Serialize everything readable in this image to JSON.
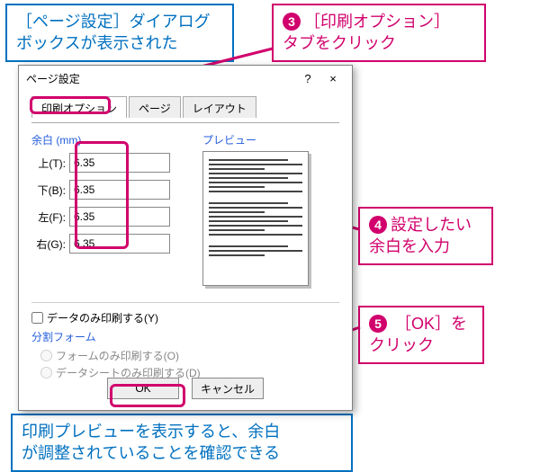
{
  "callouts": {
    "top_left": "［ページ設定］ダイアログ\nボックスが表示された",
    "top_right_num": "3",
    "top_right": "［印刷オプション］\nタブをクリック",
    "mid_right_num": "4",
    "mid_right": "設定したい\n余白を入力",
    "low_right_num": "5",
    "low_right": " ［OK］を\nクリック",
    "bottom": "印刷プレビューを表示すると、余白\nが調整されていることを確認できる"
  },
  "dialog": {
    "title": "ページ設定",
    "help": "?",
    "close": "×",
    "tabs": {
      "print_options": "印刷オプション",
      "page": "ページ",
      "layout": "レイアウト"
    },
    "margins_title": "余白 (mm)",
    "margins": {
      "top_label": "上(T):",
      "top_value": "6.35",
      "bottom_label": "下(B):",
      "bottom_value": "6.35",
      "left_label": "左(F):",
      "left_value": "6.35",
      "right_label": "右(G):",
      "right_value": "6.35"
    },
    "preview_title": "プレビュー",
    "data_only": "データのみ印刷する(Y)",
    "split_form": "分割フォーム",
    "radio_form": "フォームのみ印刷する(O)",
    "radio_sheet": "データシートのみ印刷する(D)",
    "ok": "OK",
    "cancel": "キャンセル"
  }
}
